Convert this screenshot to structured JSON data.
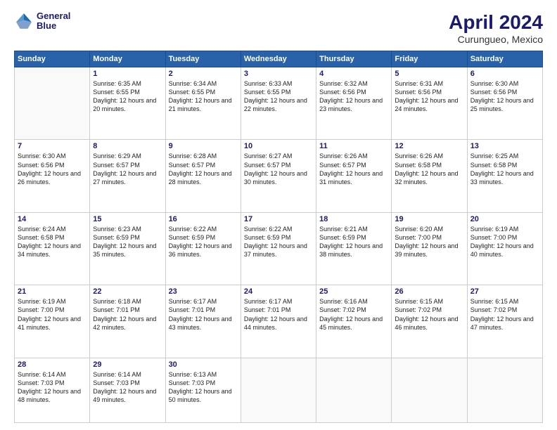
{
  "header": {
    "logo": {
      "line1": "General",
      "line2": "Blue"
    },
    "title": "April 2024",
    "subtitle": "Curungueo, Mexico"
  },
  "calendar": {
    "weekdays": [
      "Sunday",
      "Monday",
      "Tuesday",
      "Wednesday",
      "Thursday",
      "Friday",
      "Saturday"
    ],
    "weeks": [
      [
        {
          "day": "",
          "info": ""
        },
        {
          "day": "1",
          "info": "Sunrise: 6:35 AM\nSunset: 6:55 PM\nDaylight: 12 hours\nand 20 minutes."
        },
        {
          "day": "2",
          "info": "Sunrise: 6:34 AM\nSunset: 6:55 PM\nDaylight: 12 hours\nand 21 minutes."
        },
        {
          "day": "3",
          "info": "Sunrise: 6:33 AM\nSunset: 6:55 PM\nDaylight: 12 hours\nand 22 minutes."
        },
        {
          "day": "4",
          "info": "Sunrise: 6:32 AM\nSunset: 6:56 PM\nDaylight: 12 hours\nand 23 minutes."
        },
        {
          "day": "5",
          "info": "Sunrise: 6:31 AM\nSunset: 6:56 PM\nDaylight: 12 hours\nand 24 minutes."
        },
        {
          "day": "6",
          "info": "Sunrise: 6:30 AM\nSunset: 6:56 PM\nDaylight: 12 hours\nand 25 minutes."
        }
      ],
      [
        {
          "day": "7",
          "info": "Sunrise: 6:30 AM\nSunset: 6:56 PM\nDaylight: 12 hours\nand 26 minutes."
        },
        {
          "day": "8",
          "info": "Sunrise: 6:29 AM\nSunset: 6:57 PM\nDaylight: 12 hours\nand 27 minutes."
        },
        {
          "day": "9",
          "info": "Sunrise: 6:28 AM\nSunset: 6:57 PM\nDaylight: 12 hours\nand 28 minutes."
        },
        {
          "day": "10",
          "info": "Sunrise: 6:27 AM\nSunset: 6:57 PM\nDaylight: 12 hours\nand 30 minutes."
        },
        {
          "day": "11",
          "info": "Sunrise: 6:26 AM\nSunset: 6:57 PM\nDaylight: 12 hours\nand 31 minutes."
        },
        {
          "day": "12",
          "info": "Sunrise: 6:26 AM\nSunset: 6:58 PM\nDaylight: 12 hours\nand 32 minutes."
        },
        {
          "day": "13",
          "info": "Sunrise: 6:25 AM\nSunset: 6:58 PM\nDaylight: 12 hours\nand 33 minutes."
        }
      ],
      [
        {
          "day": "14",
          "info": "Sunrise: 6:24 AM\nSunset: 6:58 PM\nDaylight: 12 hours\nand 34 minutes."
        },
        {
          "day": "15",
          "info": "Sunrise: 6:23 AM\nSunset: 6:59 PM\nDaylight: 12 hours\nand 35 minutes."
        },
        {
          "day": "16",
          "info": "Sunrise: 6:22 AM\nSunset: 6:59 PM\nDaylight: 12 hours\nand 36 minutes."
        },
        {
          "day": "17",
          "info": "Sunrise: 6:22 AM\nSunset: 6:59 PM\nDaylight: 12 hours\nand 37 minutes."
        },
        {
          "day": "18",
          "info": "Sunrise: 6:21 AM\nSunset: 6:59 PM\nDaylight: 12 hours\nand 38 minutes."
        },
        {
          "day": "19",
          "info": "Sunrise: 6:20 AM\nSunset: 7:00 PM\nDaylight: 12 hours\nand 39 minutes."
        },
        {
          "day": "20",
          "info": "Sunrise: 6:19 AM\nSunset: 7:00 PM\nDaylight: 12 hours\nand 40 minutes."
        }
      ],
      [
        {
          "day": "21",
          "info": "Sunrise: 6:19 AM\nSunset: 7:00 PM\nDaylight: 12 hours\nand 41 minutes."
        },
        {
          "day": "22",
          "info": "Sunrise: 6:18 AM\nSunset: 7:01 PM\nDaylight: 12 hours\nand 42 minutes."
        },
        {
          "day": "23",
          "info": "Sunrise: 6:17 AM\nSunset: 7:01 PM\nDaylight: 12 hours\nand 43 minutes."
        },
        {
          "day": "24",
          "info": "Sunrise: 6:17 AM\nSunset: 7:01 PM\nDaylight: 12 hours\nand 44 minutes."
        },
        {
          "day": "25",
          "info": "Sunrise: 6:16 AM\nSunset: 7:02 PM\nDaylight: 12 hours\nand 45 minutes."
        },
        {
          "day": "26",
          "info": "Sunrise: 6:15 AM\nSunset: 7:02 PM\nDaylight: 12 hours\nand 46 minutes."
        },
        {
          "day": "27",
          "info": "Sunrise: 6:15 AM\nSunset: 7:02 PM\nDaylight: 12 hours\nand 47 minutes."
        }
      ],
      [
        {
          "day": "28",
          "info": "Sunrise: 6:14 AM\nSunset: 7:03 PM\nDaylight: 12 hours\nand 48 minutes."
        },
        {
          "day": "29",
          "info": "Sunrise: 6:14 AM\nSunset: 7:03 PM\nDaylight: 12 hours\nand 49 minutes."
        },
        {
          "day": "30",
          "info": "Sunrise: 6:13 AM\nSunset: 7:03 PM\nDaylight: 12 hours\nand 50 minutes."
        },
        {
          "day": "",
          "info": ""
        },
        {
          "day": "",
          "info": ""
        },
        {
          "day": "",
          "info": ""
        },
        {
          "day": "",
          "info": ""
        }
      ]
    ]
  }
}
